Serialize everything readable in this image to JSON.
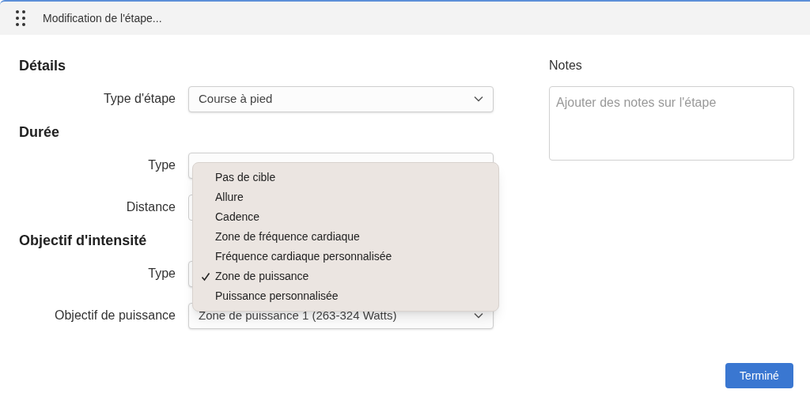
{
  "window": {
    "title": "Modification de l'étape..."
  },
  "sections": [
    {
      "heading": "Détails",
      "fields": [
        {
          "label": "Type d'étape",
          "kind": "select",
          "value": "Course à pied"
        }
      ]
    },
    {
      "heading": "Durée",
      "fields": [
        {
          "label": "Type",
          "kind": "select"
        },
        {
          "label": "Distance",
          "kind": "input"
        }
      ]
    },
    {
      "heading": "Objectif d'intensité",
      "fields": [
        {
          "label": "Type",
          "kind": "select"
        },
        {
          "label": "Objectif de puissance",
          "kind": "select",
          "value": "Zone de puissance 1 (263-324 Watts)"
        }
      ]
    }
  ],
  "dropdown_menu": {
    "items": [
      {
        "label": "Pas de cible",
        "selected": false
      },
      {
        "label": "Allure",
        "selected": false
      },
      {
        "label": "Cadence",
        "selected": false
      },
      {
        "label": "Zone de fréquence cardiaque",
        "selected": false
      },
      {
        "label": "Fréquence cardiaque personnalisée",
        "selected": false
      },
      {
        "label": "Zone de puissance",
        "selected": true
      },
      {
        "label": "Puissance personnalisée",
        "selected": false
      }
    ]
  },
  "notes": {
    "label": "Notes",
    "placeholder": "Ajouter des notes sur l'étape"
  },
  "buttons": [
    "Terminé"
  ]
}
